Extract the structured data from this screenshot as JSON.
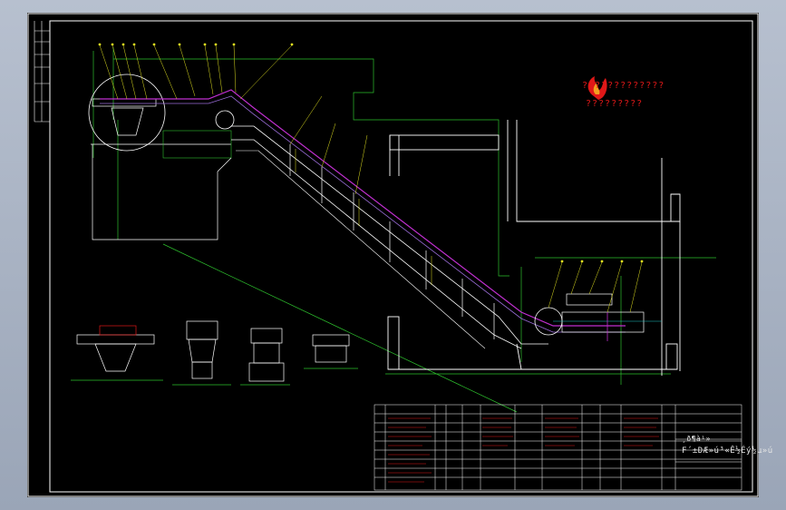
{
  "logo": {
    "line1": "?????????????",
    "line2": "?????????"
  },
  "title_block": {
    "drawing_title": "F´±ÐÆ»ú³«Ê½Éý½µ»ú",
    "code": "¸ð¶à¹»"
  },
  "colors": {
    "background": "#000000",
    "frame": "#ffffff",
    "dimension": "#2dbf2d",
    "conveyor": "#c02fd0",
    "structure": "#ffffff",
    "leader": "#e0e020",
    "accent_red": "#e01818",
    "cyan": "#20c8c8"
  }
}
